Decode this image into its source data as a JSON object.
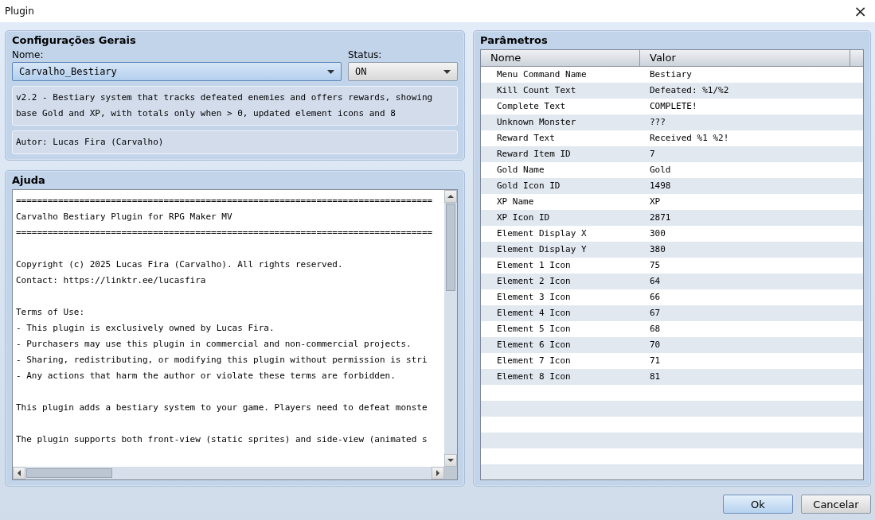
{
  "window": {
    "title": "Plugin",
    "close": "×"
  },
  "general": {
    "title": "Configurações Gerais",
    "name_label": "Nome:",
    "name_value": "Carvalho_Bestiary",
    "status_label": "Status:",
    "status_value": "ON",
    "description": [
      "v2.2 - Bestiary system that tracks defeated enemies and offers rewards, showing",
      "base Gold and XP, with totals only when > 0, updated element icons and 8"
    ],
    "author": "Autor: Lucas Fira (Carvalho)"
  },
  "help": {
    "title": "Ajuda",
    "blocks": [
      [
        "===============================================================================",
        "Carvalho Bestiary Plugin for RPG Maker MV",
        "==============================================================================="
      ],
      [
        "Copyright (c) 2025 Lucas Fira (Carvalho). All rights reserved.",
        "Contact: https://linktr.ee/lucasfira"
      ],
      [
        "Terms of Use:",
        "- This plugin is exclusively owned by Lucas Fira.",
        "- Purchasers may use this plugin in commercial and non-commercial projects.",
        "- Sharing, redistributing, or modifying this plugin without permission is stri",
        "- Any actions that harm the author or violate these terms are forbidden."
      ],
      [
        "This plugin adds a bestiary system to your game. Players need to defeat monste"
      ],
      [
        "The plugin supports both front-view (static sprites) and side-view (animated s"
      ]
    ]
  },
  "parameters": {
    "title": "Parâmetros",
    "columns": [
      "Nome",
      "Valor"
    ],
    "rows": [
      {
        "name": "Menu Command Name",
        "value": "Bestiary"
      },
      {
        "name": "Kill Count Text",
        "value": "Defeated: %1/%2"
      },
      {
        "name": "Complete Text",
        "value": "COMPLETE!"
      },
      {
        "name": "Unknown Monster",
        "value": "???"
      },
      {
        "name": "Reward Text",
        "value": "Received %1 %2!"
      },
      {
        "name": "Reward Item ID",
        "value": "7"
      },
      {
        "name": "Gold Name",
        "value": "Gold"
      },
      {
        "name": "Gold Icon ID",
        "value": "1498"
      },
      {
        "name": "XP Name",
        "value": "XP"
      },
      {
        "name": "XP Icon ID",
        "value": "2871"
      },
      {
        "name": "Element Display X",
        "value": "300"
      },
      {
        "name": "Element Display Y",
        "value": "380"
      },
      {
        "name": "Element 1 Icon",
        "value": "75"
      },
      {
        "name": "Element 2 Icon",
        "value": "64"
      },
      {
        "name": "Element 3 Icon",
        "value": "66"
      },
      {
        "name": "Element 4 Icon",
        "value": "67"
      },
      {
        "name": "Element 5 Icon",
        "value": "68"
      },
      {
        "name": "Element 6 Icon",
        "value": "70"
      },
      {
        "name": "Element 7 Icon",
        "value": "71"
      },
      {
        "name": "Element 8 Icon",
        "value": "81"
      }
    ]
  },
  "buttons": [
    {
      "label": "Ok",
      "kind": "primary"
    },
    {
      "label": "Cancelar",
      "kind": "secondary"
    }
  ]
}
